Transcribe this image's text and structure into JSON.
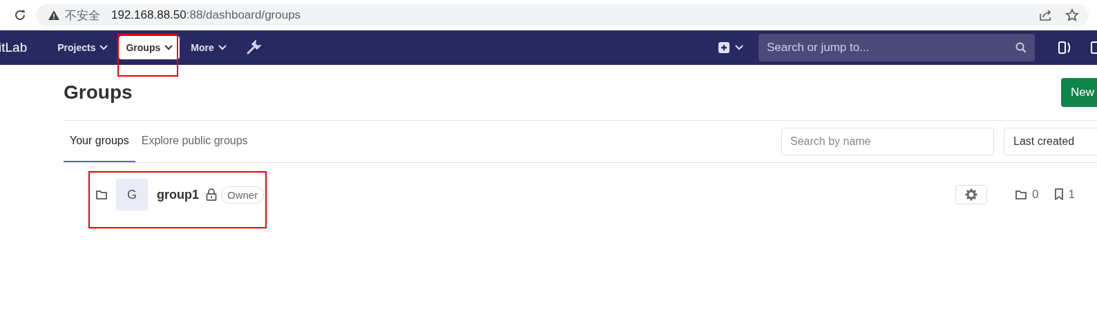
{
  "browser": {
    "security_label": "不安全",
    "url_host": "192.168.88.50",
    "url_rest": ":88/dashboard/groups"
  },
  "navbar": {
    "brand": "itLab",
    "items": [
      {
        "label": "Projects",
        "selected": false
      },
      {
        "label": "Groups",
        "selected": true
      },
      {
        "label": "More",
        "selected": false
      }
    ],
    "search": {
      "placeholder": "Search or jump to..."
    }
  },
  "page": {
    "title": "Groups",
    "new_button": "New"
  },
  "tabs": [
    {
      "label": "Your groups",
      "selected": true
    },
    {
      "label": "Explore public groups",
      "selected": false
    }
  ],
  "filter": {
    "search": {
      "placeholder": "Search by name"
    },
    "sort": "Last created"
  },
  "groups": [
    {
      "avatar": "G",
      "name": "group1",
      "role": "Owner",
      "subgroups": "0",
      "projects": "1"
    }
  ]
}
